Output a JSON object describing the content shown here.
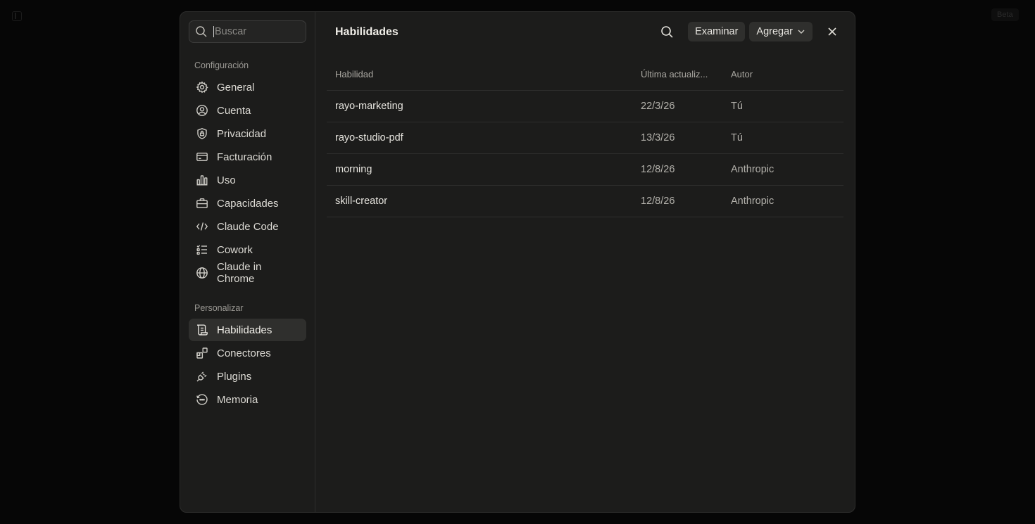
{
  "search": {
    "placeholder": "Buscar",
    "value": ""
  },
  "sidebar": {
    "config_label": "Configuración",
    "config_items": [
      {
        "label": "General",
        "icon": "gear-icon"
      },
      {
        "label": "Cuenta",
        "icon": "user-circle-icon"
      },
      {
        "label": "Privacidad",
        "icon": "shield-lock-icon"
      },
      {
        "label": "Facturación",
        "icon": "credit-card-icon"
      },
      {
        "label": "Uso",
        "icon": "bar-chart-icon"
      },
      {
        "label": "Capacidades",
        "icon": "toolbox-icon"
      },
      {
        "label": "Claude Code",
        "icon": "code-icon"
      },
      {
        "label": "Cowork",
        "icon": "checklist-icon"
      },
      {
        "label": "Claude in Chrome",
        "icon": "globe-icon"
      }
    ],
    "personalize_label": "Personalizar",
    "personalize_items": [
      {
        "label": "Habilidades",
        "icon": "scroll-icon",
        "active": true
      },
      {
        "label": "Conectores",
        "icon": "blocks-icon"
      },
      {
        "label": "Plugins",
        "icon": "plug-icon"
      },
      {
        "label": "Memoria",
        "icon": "memory-icon"
      }
    ]
  },
  "header": {
    "title": "Habilidades",
    "browse_label": "Examinar",
    "add_label": "Agregar"
  },
  "table": {
    "columns": [
      "Habilidad",
      "Última actualiz...",
      "Autor"
    ],
    "rows": [
      {
        "name": "rayo-marketing",
        "updated": "22/3/26",
        "author": "Tú"
      },
      {
        "name": "rayo-studio-pdf",
        "updated": "13/3/26",
        "author": "Tú"
      },
      {
        "name": "morning",
        "updated": "12/8/26",
        "author": "Anthropic"
      },
      {
        "name": "skill-creator",
        "updated": "12/8/26",
        "author": "Anthropic"
      }
    ]
  },
  "background": {
    "beta_label": "Beta"
  }
}
